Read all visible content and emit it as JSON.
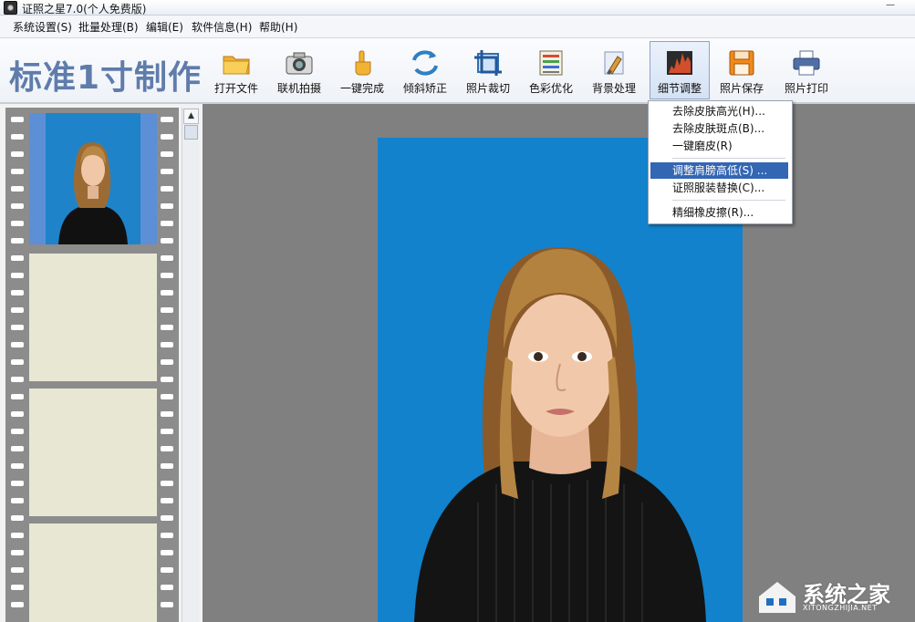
{
  "window": {
    "title": "证照之星7.0(个人免费版)"
  },
  "menu": [
    {
      "label": "系统设置(S)"
    },
    {
      "label": "批量处理(B)"
    },
    {
      "label": "编辑(E)"
    },
    {
      "label": "软件信息(H)"
    },
    {
      "label": "帮助(H)"
    }
  ],
  "toolbar": {
    "brand": "标准1寸制作",
    "tools": [
      {
        "label": "打开文件",
        "icon": "folder-icon"
      },
      {
        "label": "联机拍摄",
        "icon": "camera-icon"
      },
      {
        "label": "一键完成",
        "icon": "hand-pointer-icon"
      },
      {
        "label": "倾斜矫正",
        "icon": "rotate-icon"
      },
      {
        "label": "照片裁切",
        "icon": "crop-icon"
      },
      {
        "label": "色彩优化",
        "icon": "color-adjust-icon"
      },
      {
        "label": "背景处理",
        "icon": "brush-icon"
      },
      {
        "label": "细节调整",
        "icon": "detail-chart-icon",
        "active": true
      },
      {
        "label": "照片保存",
        "icon": "floppy-save-icon"
      },
      {
        "label": "照片打印",
        "icon": "printer-icon"
      }
    ]
  },
  "dropdown": {
    "items": [
      {
        "label": "去除皮肤高光(H)..."
      },
      {
        "label": "去除皮肤斑点(B)..."
      },
      {
        "label": "一键磨皮(R)"
      },
      {
        "label": "调整肩膀高低(S) ...",
        "highlighted": true
      },
      {
        "label": "证照服装替换(C)..."
      },
      {
        "label": "精细橡皮擦(R)..."
      }
    ]
  },
  "colors": {
    "photo_background": "#1282cc",
    "selected_frame": "#5d8fd6",
    "empty_frame": "#e7e7d4",
    "menu_highlight": "#3366b3",
    "brand_text": "#5f7cab"
  },
  "watermark": {
    "text": "系统之家",
    "sub": "XITONGZHIJIA.NET"
  }
}
